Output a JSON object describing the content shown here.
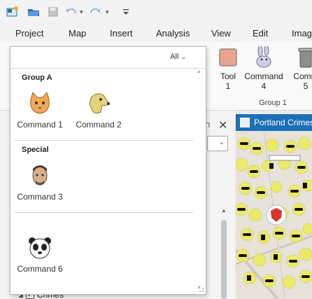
{
  "menu": [
    "Project",
    "Map",
    "Insert",
    "Analysis",
    "View",
    "Edit",
    "Imag"
  ],
  "ribbon": {
    "commands": [
      {
        "label": "Tool",
        "sub": "1",
        "icon": "tool-icon"
      },
      {
        "label": "Command",
        "sub": "4",
        "icon": "rabbit-icon"
      },
      {
        "label": "Comm",
        "sub": "5",
        "icon": "trash-can-icon"
      }
    ],
    "group_label": "Group 1"
  },
  "gallery": {
    "filter_label": "All",
    "sections": [
      {
        "title": "Group A",
        "items": [
          {
            "label": "Command 1",
            "icon": "cat-icon"
          },
          {
            "label": "Command 2",
            "icon": "dog-icon"
          }
        ]
      },
      {
        "title": "Special",
        "items": [
          {
            "label": "Command 3",
            "icon": "man-face-icon"
          }
        ]
      },
      {
        "title": "",
        "items": [
          {
            "label": "Command 6",
            "icon": "panda-icon"
          }
        ]
      }
    ]
  },
  "map": {
    "tab_title": "Portland Crimes",
    "layer_label": "Crimes"
  },
  "colors": {
    "accent_blue": "#1d6fb6",
    "crime_yellow": "#ecea6a"
  }
}
